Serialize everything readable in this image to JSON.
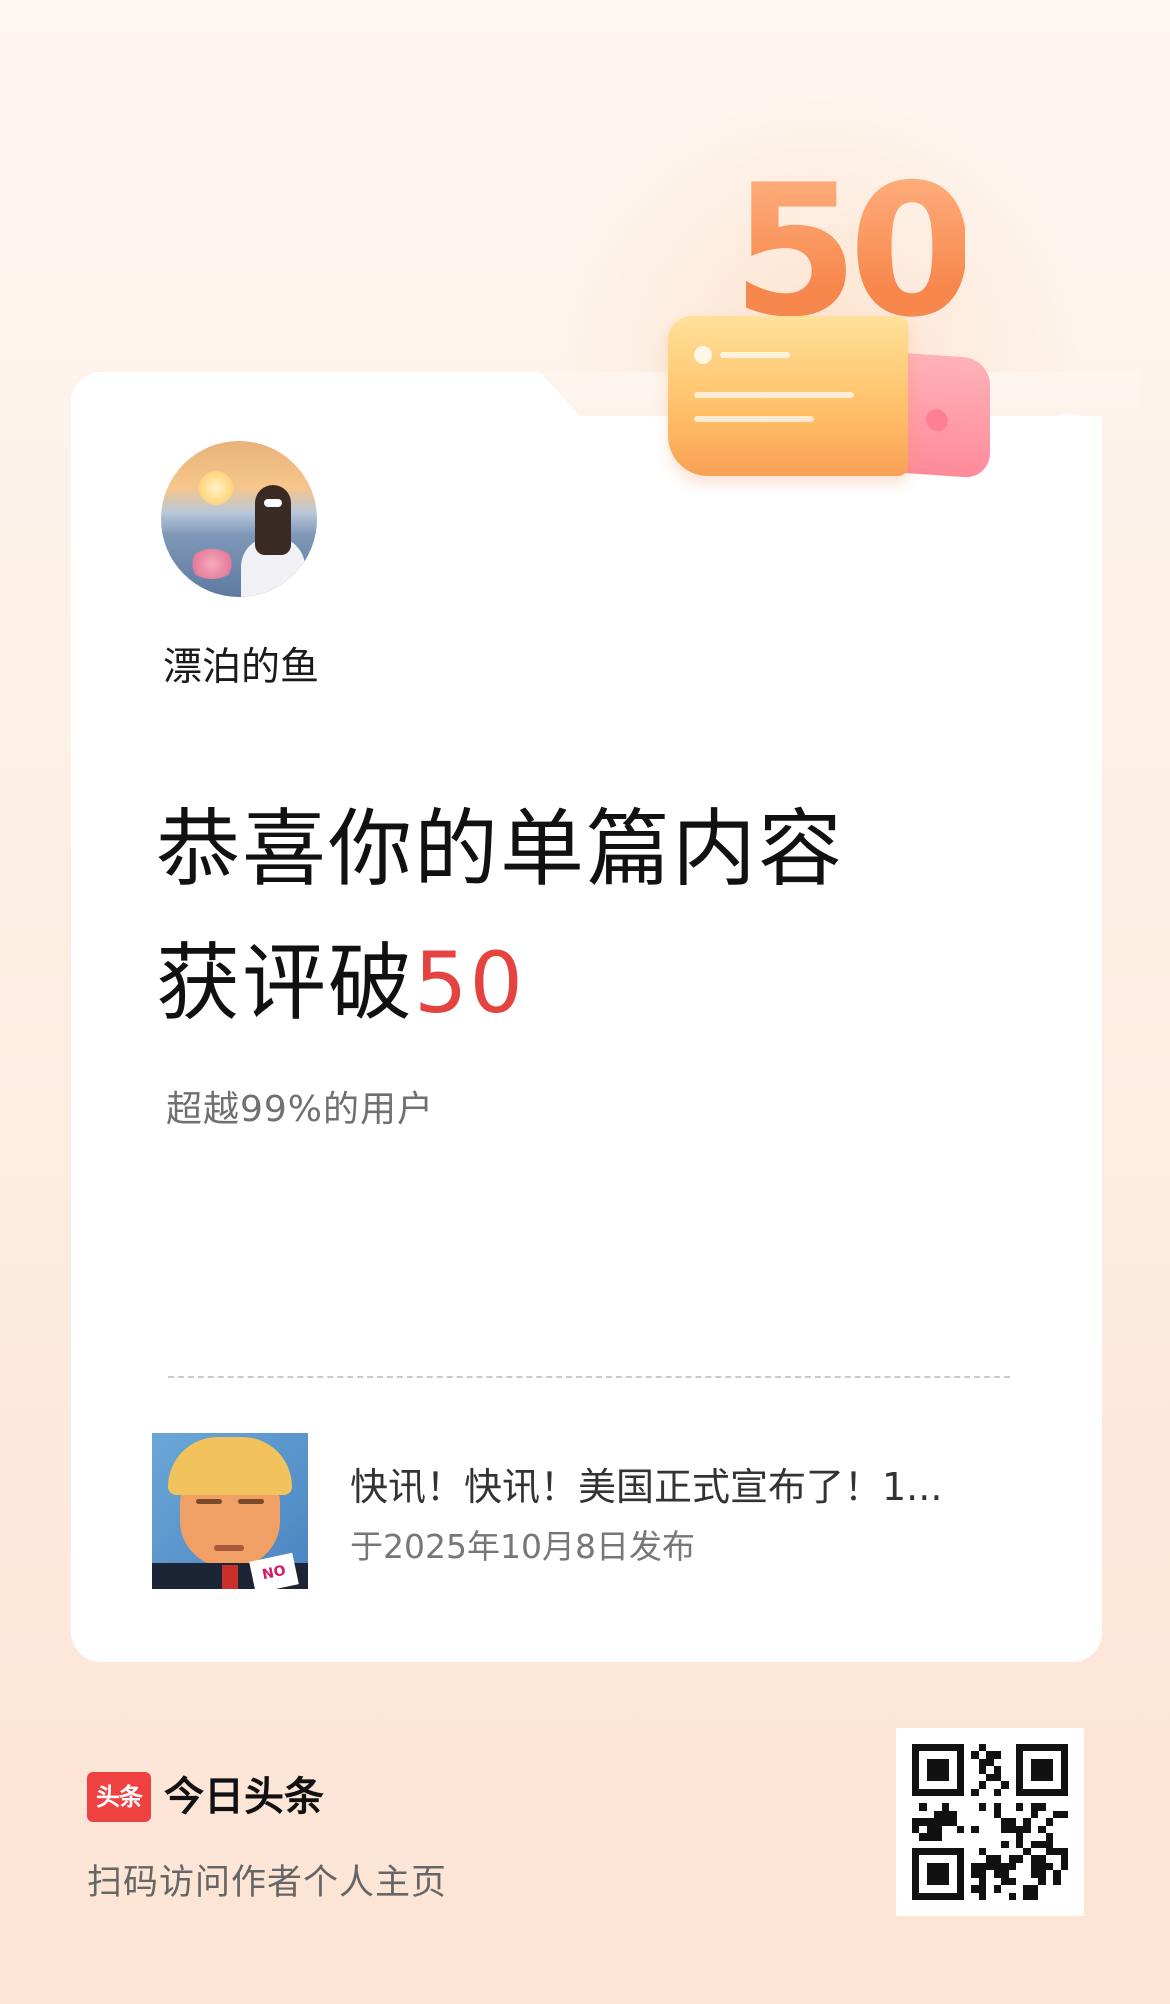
{
  "badge": {
    "number": "50"
  },
  "author": {
    "name": "漂泊的鱼"
  },
  "headline": {
    "line1": "恭喜你的单篇内容",
    "line2_prefix": "获评破",
    "line2_number": "50"
  },
  "subtitle": "超越99%的用户",
  "article": {
    "title": "快讯！快讯！美国正式宣布了！1...",
    "date": "于2025年10月8日发布",
    "thumbnail_badge": "NO"
  },
  "footer": {
    "logo_text": "头条",
    "brand": "今日头条",
    "caption": "扫码访问作者个人主页"
  },
  "colors": {
    "accent_red": "#e5433f",
    "badge_orange": "#f7874c",
    "logo_red": "#f04142"
  }
}
